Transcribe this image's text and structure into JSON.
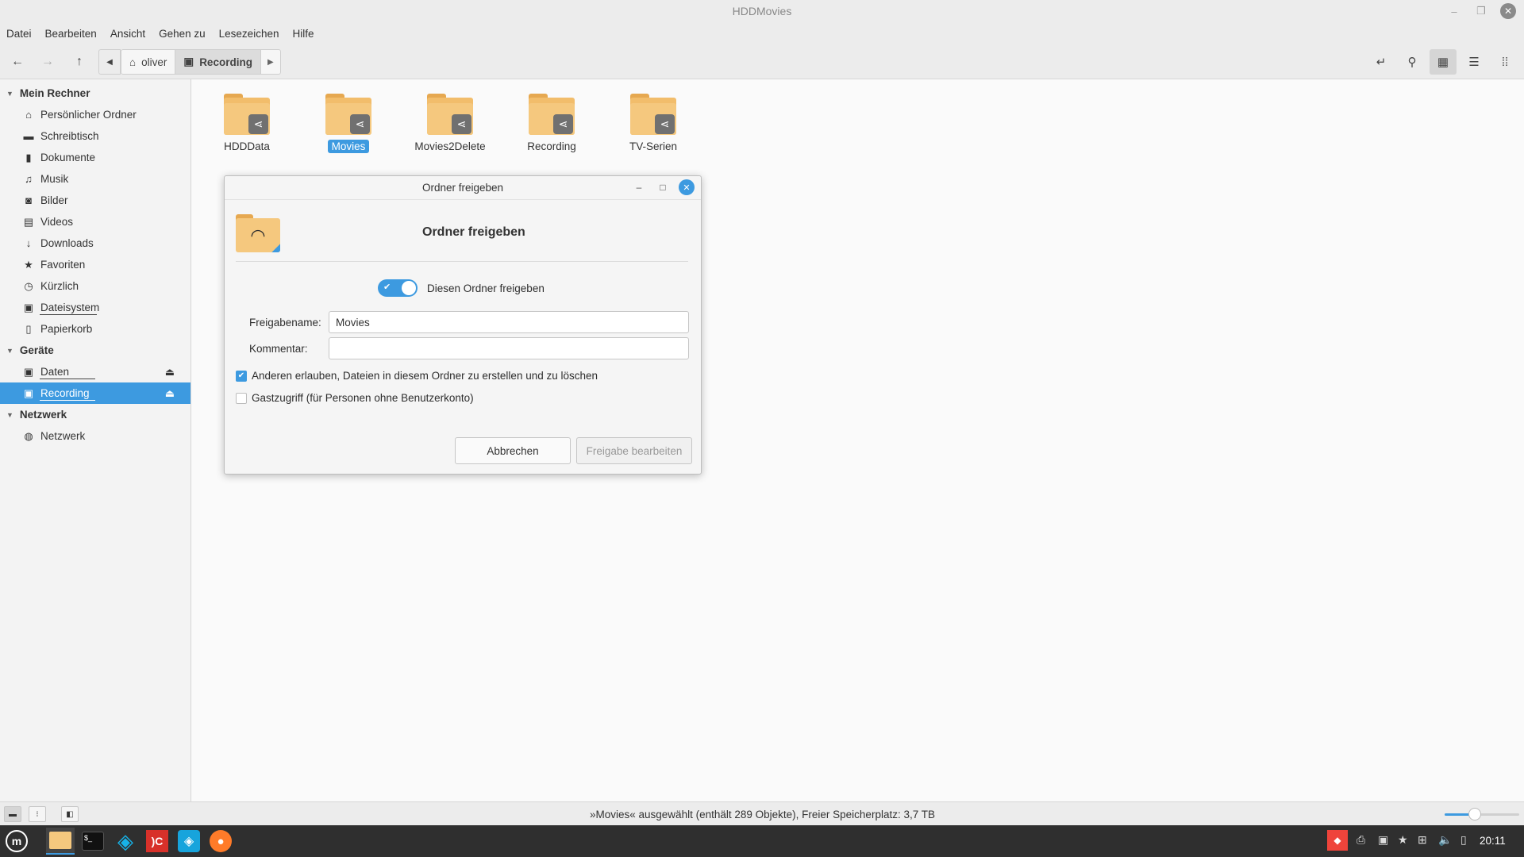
{
  "window": {
    "title": "HDDMovies"
  },
  "menu": [
    "Datei",
    "Bearbeiten",
    "Ansicht",
    "Gehen zu",
    "Lesezeichen",
    "Hilfe"
  ],
  "path": [
    {
      "label": "oliver",
      "icon": "home-icon"
    },
    {
      "label": "Recording",
      "icon": "drive-icon"
    }
  ],
  "sidebar": {
    "sections": [
      {
        "title": "Mein Rechner",
        "items": [
          {
            "label": "Persönlicher Ordner",
            "icon": "home-icon"
          },
          {
            "label": "Schreibtisch",
            "icon": "desktop-icon"
          },
          {
            "label": "Dokumente",
            "icon": "document-icon"
          },
          {
            "label": "Musik",
            "icon": "music-icon"
          },
          {
            "label": "Bilder",
            "icon": "camera-icon"
          },
          {
            "label": "Videos",
            "icon": "film-icon"
          },
          {
            "label": "Downloads",
            "icon": "download-icon"
          },
          {
            "label": "Favoriten",
            "icon": "star-icon"
          },
          {
            "label": "Kürzlich",
            "icon": "clock-icon"
          },
          {
            "label": "Dateisystem",
            "icon": "drive-icon"
          },
          {
            "label": "Papierkorb",
            "icon": "trash-icon"
          }
        ]
      },
      {
        "title": "Geräte",
        "items": [
          {
            "label": "Daten",
            "icon": "drive-icon"
          },
          {
            "label": "Recording",
            "icon": "drive-icon"
          }
        ]
      },
      {
        "title": "Netzwerk",
        "items": [
          {
            "label": "Netzwerk",
            "icon": "network-icon"
          }
        ]
      }
    ]
  },
  "files": [
    "HDDData",
    "Movies",
    "Movies2Delete",
    "Recording",
    "TV-Serien"
  ],
  "selected_file": "Movies",
  "dialog": {
    "title": "Ordner freigeben",
    "heading": "Ordner freigeben",
    "toggle_label": "Diesen Ordner freigeben",
    "toggle_on": true,
    "name_label": "Freigabename:",
    "name_value": "Movies",
    "comment_label": "Kommentar:",
    "comment_value": "",
    "allow_label": "Anderen erlauben, Dateien in diesem Ordner zu erstellen und zu löschen",
    "allow_checked": true,
    "guest_label": "Gastzugriff (für Personen ohne Benutzerkonto)",
    "guest_checked": false,
    "cancel_label": "Abbrechen",
    "submit_label": "Freigabe bearbeiten"
  },
  "status": {
    "text": "»Movies« ausgewählt (enthält 289 Objekte), Freier Speicherplatz: 3,7 TB",
    "zoom_fraction": 0.4
  },
  "taskbar": {
    "clock": "20:11"
  },
  "colors": {
    "accent": "#3d9ae0",
    "folder": "#f5c87e",
    "taskbar": "#2f2f2f"
  }
}
